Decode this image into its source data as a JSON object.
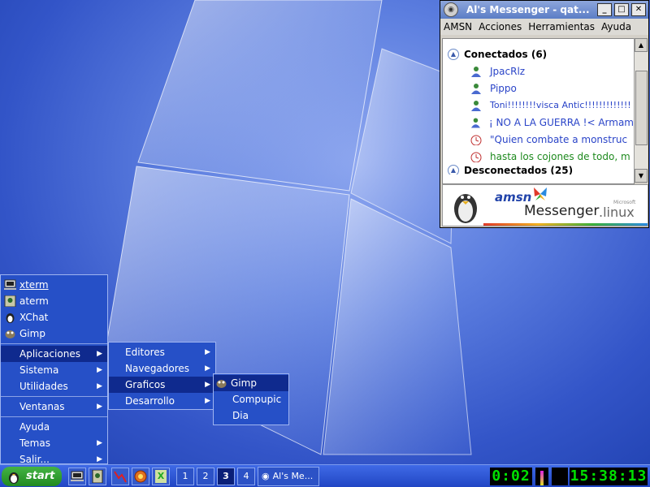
{
  "messenger": {
    "title": "Al's Messenger - qat...",
    "minimize": "_",
    "maximize": "□",
    "close": "✕",
    "menu": [
      "AMSN",
      "Acciones",
      "Herramientas",
      "Ayuda"
    ],
    "group_online": "Conectados (6)",
    "group_offline": "Desconectados (25)",
    "contacts": [
      {
        "name": "JpacRlz",
        "color": "#2a44c8",
        "status": "online"
      },
      {
        "name": "Pippo",
        "color": "#2a44c8",
        "status": "online"
      },
      {
        "name": "Toni!!!!!!!!visca Antic!!!!!!!!!!!!!",
        "color": "#2a44c8",
        "status": "online"
      },
      {
        "name": "¡ NO A LA GUERRA !< Armam",
        "color": "#2a44c8",
        "status": "online"
      },
      {
        "name": "\"Quien combate a monstruc",
        "color": "#2a44c8",
        "status": "away"
      },
      {
        "name": "hasta los cojones de todo, m",
        "color": "#1e8a1e",
        "status": "away"
      }
    ],
    "banner_amsn": "amsn",
    "banner_messenger": "Messenger",
    "banner_linux": ".linux",
    "banner_microsoft": "Microsoft"
  },
  "start_menu": {
    "apps": [
      "xterm",
      "aterm",
      "XChat",
      "Gimp"
    ],
    "categories": [
      "Aplicaciones",
      "Sistema",
      "Utilidades"
    ],
    "ventanas": "Ventanas",
    "bottom": [
      "Ayuda",
      "Temas",
      "Salir..."
    ],
    "apps_submenu": [
      "Editores",
      "Navegadores",
      "Graficos",
      "Desarrollo"
    ],
    "graficos_submenu": [
      "Gimp",
      "Compupic",
      "Dia"
    ]
  },
  "taskbar": {
    "start_label": "start",
    "workspaces": [
      "1",
      "2",
      "3",
      "4"
    ],
    "active_workspace": "3",
    "task_label": "Al's Me...",
    "timer": "0:02",
    "clock": "15:38:13"
  }
}
